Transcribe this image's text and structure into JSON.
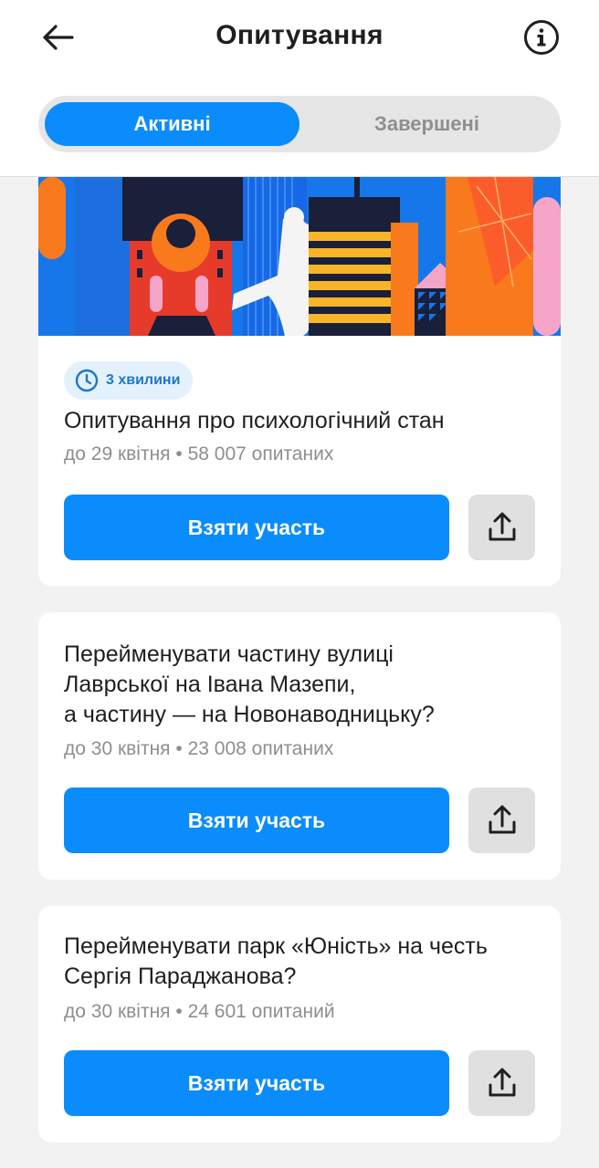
{
  "header": {
    "title": "Опитування",
    "back_icon": "arrow-left-icon",
    "info_icon": "info-icon"
  },
  "tabs": [
    {
      "label": "Активні",
      "active": true
    },
    {
      "label": "Завершені",
      "active": false
    }
  ],
  "colors": {
    "accent": "#0a8cfd",
    "badge_bg": "#e3f1fd",
    "badge_text": "#1a77c9",
    "share_bg": "#e0e0e0"
  },
  "polls": [
    {
      "badge": "3 хвилини",
      "badge_icon": "clock-icon",
      "title": "Опитування про психологічний стан",
      "meta": "до 29 квітня • 58 007 опитаних",
      "join_label": "Взяти участь",
      "share_icon": "share-icon"
    },
    {
      "title": "Перейменувати частину вулиці\nЛаврської на Івана Мазепи,\nа частину — на Новонаводницьку?",
      "meta": "до 30 квітня • 23 008 опитаних",
      "join_label": "Взяти участь",
      "share_icon": "share-icon"
    },
    {
      "title": "Перейменувати парк «Юність» на честь\nСергія Параджанова?",
      "meta": "до 30 квітня • 24 601 опитаний",
      "join_label": "Взяти участь",
      "share_icon": "share-icon"
    }
  ]
}
